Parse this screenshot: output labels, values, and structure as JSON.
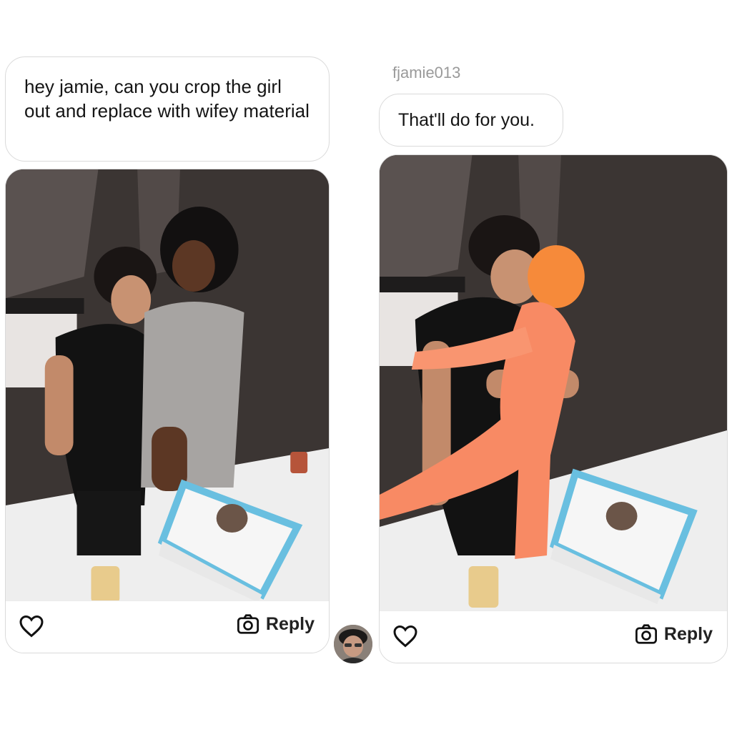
{
  "left_message": {
    "text": "hey jamie, can you crop the girl out and replace with wifey material"
  },
  "right_message": {
    "sender": "fjamie013",
    "text": "That'll do for you."
  },
  "left_card": {
    "photo_alt": "birthday-cake-photo",
    "reply_label": "Reply",
    "like_icon": "heart-icon",
    "reply_icon": "camera-icon"
  },
  "right_card": {
    "photo_alt": "edited-birthday-cake-photo",
    "reply_label": "Reply",
    "like_icon": "heart-icon",
    "reply_icon": "camera-icon"
  },
  "avatar": {
    "icon": "user-avatar"
  },
  "colors": {
    "bubble_border": "#dadada",
    "sender_text": "#9a9a9a",
    "doll_orange": "#f88a64"
  }
}
